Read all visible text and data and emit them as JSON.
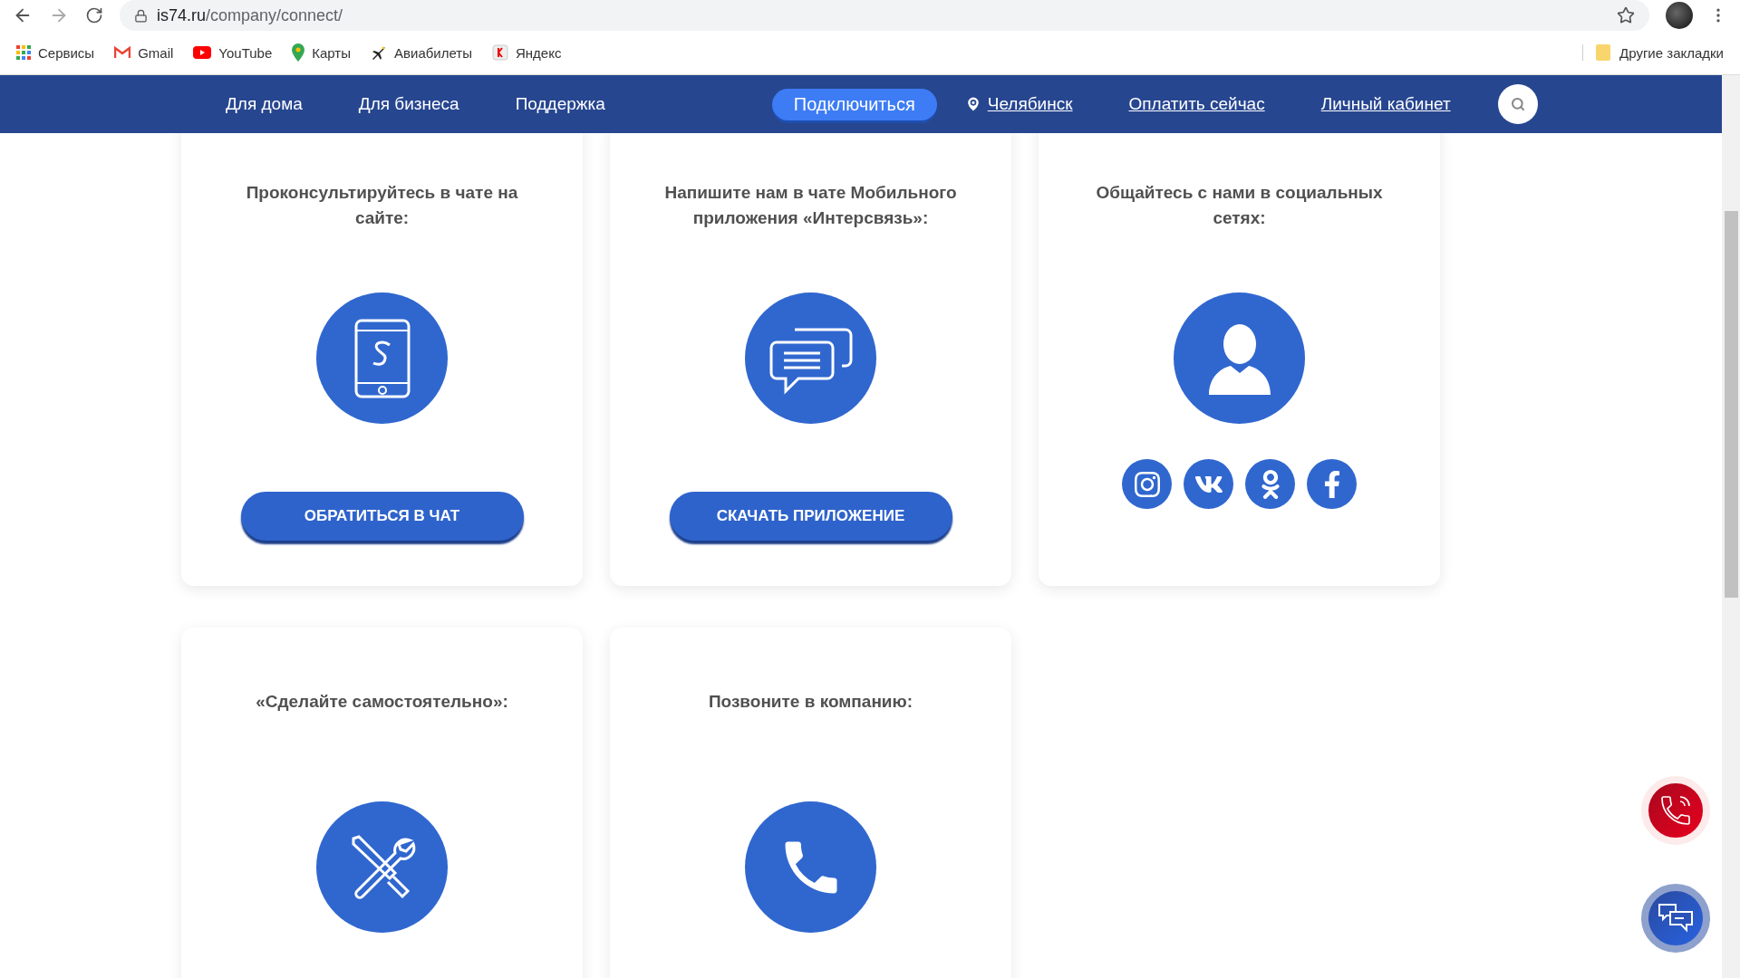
{
  "browser": {
    "url_host": "is74.ru",
    "url_path": "/company/connect/",
    "bookmarks": [
      {
        "label": "Сервисы",
        "kind": "apps"
      },
      {
        "label": "Gmail",
        "kind": "gmail"
      },
      {
        "label": "YouTube",
        "kind": "youtube"
      },
      {
        "label": "Карты",
        "kind": "maps"
      },
      {
        "label": "Авиабилеты",
        "kind": "plane"
      },
      {
        "label": "Яндекс",
        "kind": "yandex"
      }
    ],
    "other_bookmarks": "Другие закладки"
  },
  "nav": {
    "items": [
      {
        "label": "Для дома",
        "kind": "plain"
      },
      {
        "label": "Для бизнеса",
        "kind": "plain"
      },
      {
        "label": "Поддержка",
        "kind": "plain"
      },
      {
        "label": "Подключиться",
        "kind": "button"
      },
      {
        "label": "Челябинск",
        "kind": "location"
      },
      {
        "label": "Оплатить сейчас",
        "kind": "link"
      },
      {
        "label": "Личный кабинет",
        "kind": "link"
      }
    ]
  },
  "cards": [
    {
      "title": "Проконсультируйтесь в чате на сайте:",
      "kind": "tablet",
      "button": "ОБРАТИТЬСЯ В ЧАТ"
    },
    {
      "title": "Напишите нам в чате Мобильного приложения «Интерсвязь»:",
      "kind": "bubble",
      "button": "СКАЧАТЬ ПРИЛОЖЕНИЕ"
    },
    {
      "title": "Общайтесь с нами в социальных сетях:",
      "kind": "social"
    },
    {
      "title": "«Сделайте самостоятельно»:",
      "kind": "tools"
    },
    {
      "title": "Позвоните в компанию:",
      "kind": "phone"
    }
  ]
}
